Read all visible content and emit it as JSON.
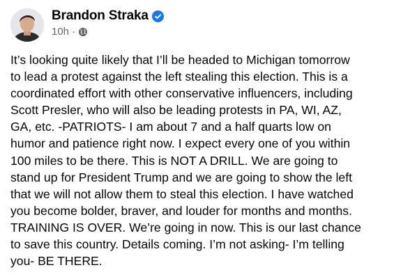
{
  "post": {
    "author": "Brandon Straka",
    "timestamp": "10h",
    "separator": "·",
    "audience_icon": "globe-icon",
    "verified_icon": "verified-badge-icon",
    "lines": [
      "It’s looking quite likely that I’ll be headed to Michigan tomorrow",
      "to lead a protest against the left stealing this election. This is a",
      "coordinated effort with other conservative influencers, including",
      "Scott Presler, who will also be leading protests in PA, WI, AZ,",
      "GA, etc. -PATRIOTS- I am about 7 and a half quarts low on",
      "humor and patience right now. I expect every one of you within",
      "100 miles to be there. This is NOT A DRILL. We are going to",
      "stand up for President Trump and we are going to show the left",
      "that we will not allow them to steal this election. I have watched",
      "you become bolder, braver, and louder for months and months.",
      "TRAINING IS OVER. We’re going in now. This is our last chance",
      "to save this country. Details coming. I’m not asking- I’m telling",
      "you- BE THERE."
    ]
  },
  "colors": {
    "text": "#050505",
    "secondary_text": "#65676b",
    "verified_blue": "#1877f2",
    "background": "#ffffff"
  }
}
